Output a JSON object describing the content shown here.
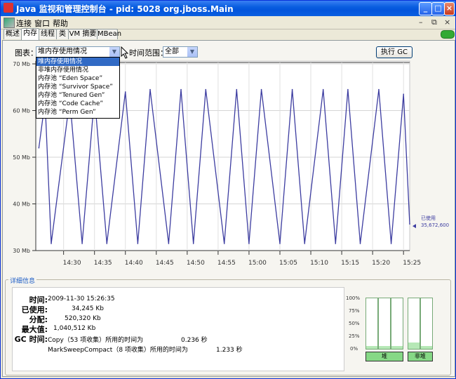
{
  "window": {
    "title": "Java 监视和管理控制台 - pid: 5028 org.jboss.Main",
    "min_label": "_",
    "max_label": "□",
    "close_label": "×"
  },
  "menu": {
    "items": [
      "连接",
      "窗口",
      "帮助"
    ],
    "win_controls": [
      "–",
      "⧉",
      "×"
    ]
  },
  "tabs": [
    "概述",
    "内存",
    "线程",
    "类",
    "VM 摘要",
    "MBean"
  ],
  "active_tab": 1,
  "toolbar": {
    "chart_label": "图表：",
    "chart_value": "堆内存使用情况",
    "range_label": "时间范围：",
    "range_value": "全部",
    "gc_button": "执行 GC"
  },
  "dropdown_options": [
    "堆内存使用情况",
    "非堆内存使用情况",
    "内存池 “Eden Space”",
    "内存池 “Survivor Space”",
    "内存池 “Tenured Gen”",
    "内存池 “Code Cache”",
    "内存池 “Perm Gen”"
  ],
  "dropdown_selected": 0,
  "chart_data": {
    "type": "line",
    "ylabel_ticks": [
      "30 Mb",
      "40 Mb",
      "50 Mb",
      "60 Mb",
      "70 Mb"
    ],
    "ylim": [
      30,
      70
    ],
    "x_ticks": [
      "14:30",
      "14:35",
      "14:40",
      "14:45",
      "14:50",
      "14:55",
      "15:00",
      "15:05",
      "15:10",
      "15:15",
      "15:20",
      "15:25"
    ],
    "series": [
      {
        "name": "已使用",
        "color": "#3c3ca0",
        "x": [
          "14:26",
          "14:27",
          "14:28",
          "14:31",
          "14:33",
          "14:35",
          "14:37",
          "14:40",
          "14:42",
          "14:44",
          "14:47",
          "14:49",
          "14:51",
          "14:53",
          "14:56",
          "14:58",
          "15:00",
          "15:02",
          "15:05",
          "15:07",
          "15:09",
          "15:12",
          "15:14",
          "15:16",
          "15:18",
          "15:21",
          "15:23",
          "15:25",
          "15:26"
        ],
        "y": [
          52,
          62,
          31.5,
          62.5,
          31.5,
          63,
          31.5,
          64,
          31.5,
          64.5,
          31.5,
          64.5,
          31.5,
          64.5,
          31.5,
          64.5,
          31.5,
          64.5,
          31.5,
          64.5,
          31.5,
          64.5,
          31.5,
          64.5,
          31.5,
          64.5,
          31.5,
          63.5,
          35.7
        ]
      }
    ],
    "current_label": "已使用",
    "current_value": "35,672,600"
  },
  "details": {
    "title": "详细信息",
    "time_label": "时间:",
    "time_value": "2009-11-30 15:26:35",
    "used_label": "已使用:",
    "used_value": "34,245 Kb",
    "committed_label": "分配:",
    "committed_value": "520,320 Kb",
    "max_label": "最大值:",
    "max_value": "1,040,512 Kb",
    "gc_label": "GC 时间:",
    "gc1_text": "Copy（53 项收集）所用的时间为",
    "gc1_time": "0.236 秒",
    "gc2_text": "MarkSweepCompact（8 项收集）所用的时间为",
    "gc2_time": "1.233 秒"
  },
  "gauges": {
    "ticks": [
      "100%",
      "75%",
      "50%",
      "25%",
      "0%"
    ],
    "bars": [
      0.05,
      0.05,
      0.05,
      0.12,
      0.05
    ],
    "buttons": [
      "堆",
      "非堆"
    ]
  }
}
